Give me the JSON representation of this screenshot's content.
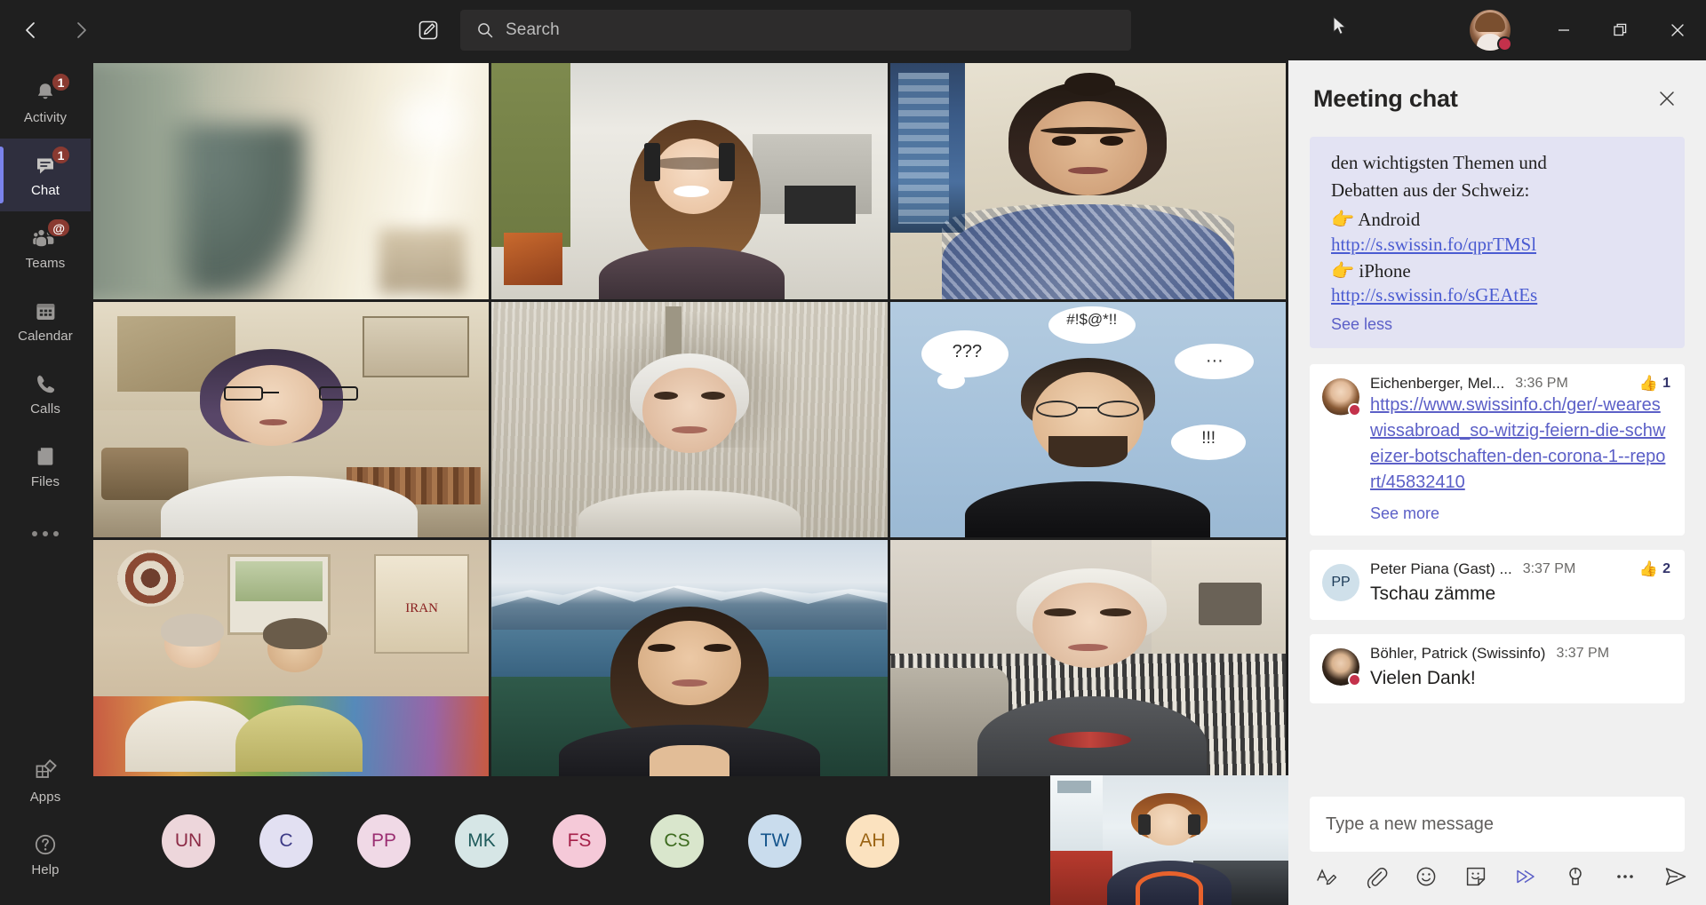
{
  "window": {
    "back_label": "Back",
    "forward_label": "Forward",
    "compose_label": "New chat",
    "minimize_label": "Minimize",
    "maximize_label": "Restore",
    "close_label": "Close",
    "user_presence": "busy",
    "presence_color": "#c4314b"
  },
  "search": {
    "placeholder": "Search",
    "value": "",
    "icon": "search-icon"
  },
  "rail": {
    "items": [
      {
        "id": "activity",
        "label": "Activity",
        "icon": "bell-icon",
        "badge": "1",
        "active": false
      },
      {
        "id": "chat",
        "label": "Chat",
        "icon": "chat-bubble-icon",
        "badge": "1",
        "active": true
      },
      {
        "id": "teams",
        "label": "Teams",
        "icon": "people-icon",
        "badge": "@",
        "active": false
      },
      {
        "id": "calendar",
        "label": "Calendar",
        "icon": "calendar-icon",
        "badge": "",
        "active": false
      },
      {
        "id": "calls",
        "label": "Calls",
        "icon": "phone-icon",
        "badge": "",
        "active": false
      },
      {
        "id": "files",
        "label": "Files",
        "icon": "file-icon",
        "badge": "",
        "active": false
      }
    ],
    "more_label": "More apps",
    "bottom": [
      {
        "id": "apps",
        "label": "Apps",
        "icon": "apps-grid-icon"
      },
      {
        "id": "help",
        "label": "Help",
        "icon": "question-circle-icon"
      }
    ],
    "active_accent": "#7b83eb",
    "badge_color": "#8a3a31"
  },
  "stage": {
    "tiles": [
      {
        "id": "tile-1",
        "position": "row1-col1"
      },
      {
        "id": "tile-2",
        "position": "row1-col2"
      },
      {
        "id": "tile-3",
        "position": "row1-col3"
      },
      {
        "id": "tile-4",
        "position": "row2-col1"
      },
      {
        "id": "tile-5",
        "position": "row2-col2"
      },
      {
        "id": "tile-6",
        "position": "row2-col3"
      },
      {
        "id": "tile-7",
        "position": "row3-col1"
      },
      {
        "id": "tile-8",
        "position": "row3-col2"
      },
      {
        "id": "tile-9",
        "position": "row3-col3"
      }
    ],
    "participant_pills": [
      {
        "initials": "UN",
        "bg": "#edd6db",
        "fg": "#8c2b46"
      },
      {
        "initials": "C",
        "bg": "#e2e0f2",
        "fg": "#3c3a86"
      },
      {
        "initials": "PP",
        "bg": "#f0d9e6",
        "fg": "#9b2f72"
      },
      {
        "initials": "MK",
        "bg": "#d6e6e6",
        "fg": "#1f5b5b"
      },
      {
        "initials": "FS",
        "bg": "#f5c9d8",
        "fg": "#a52049"
      },
      {
        "initials": "CS",
        "bg": "#d9e6cc",
        "fg": "#3d6b1f"
      },
      {
        "initials": "TW",
        "bg": "#c9dced",
        "fg": "#15558c"
      },
      {
        "initials": "AH",
        "bg": "#fbe2bf",
        "fg": "#9a6312"
      }
    ],
    "selfview_label": "Your video"
  },
  "chat": {
    "title": "Meeting chat",
    "close_label": "Close chat",
    "pinned_message": {
      "lines": [
        "den wichtigsten Themen und",
        "Debatten aus der Schweiz:"
      ],
      "items": [
        {
          "emoji": "👉",
          "label": "Android",
          "url": "http://s.swissin.fo/qprTMSl"
        },
        {
          "emoji": "👉",
          "label": "iPhone",
          "url": "http://s.swissin.fo/sGEAtEs"
        }
      ],
      "toggle_label": "See less"
    },
    "messages": [
      {
        "id": "msg-1",
        "author": "Eichenberger, Mel...",
        "time": "3:36 PM",
        "reaction_emoji": "👍",
        "reaction_count": "1",
        "link": "https://www.swissinfo.ch/ger/-weareswissabroad_so-witzig-feiern-die-schweizer-botschaften-den-corona-1--report/45832410",
        "text": "",
        "toggle_label": "See more",
        "avatar_type": "photo",
        "presence": "busy"
      },
      {
        "id": "msg-2",
        "author": "Peter Piana (Gast) ...",
        "time": "3:37 PM",
        "reaction_emoji": "👍",
        "reaction_count": "2",
        "link": "",
        "text": "Tschau zämme",
        "toggle_label": "",
        "avatar_type": "initials",
        "avatar_initials": "PP",
        "avatar_bg": "#cfe0ea",
        "avatar_fg": "#1b3a57",
        "presence": ""
      },
      {
        "id": "msg-3",
        "author": "Böhler, Patrick (Swissinfo)",
        "time": "3:37 PM",
        "reaction_emoji": "",
        "reaction_count": "",
        "link": "",
        "text": "Vielen Dank!",
        "toggle_label": "",
        "avatar_type": "photo",
        "presence": "busy"
      }
    ],
    "composer": {
      "placeholder": "Type a new message",
      "value": "",
      "tools": [
        {
          "id": "format",
          "icon": "format-text-icon",
          "label": "Format"
        },
        {
          "id": "attach",
          "icon": "paperclip-icon",
          "label": "Attach file"
        },
        {
          "id": "emoji",
          "icon": "emoji-smiley-icon",
          "label": "Emoji"
        },
        {
          "id": "giphy",
          "icon": "sticker-icon",
          "label": "Giphy"
        },
        {
          "id": "stream",
          "icon": "send-chevron-icon",
          "label": "Stream"
        },
        {
          "id": "praise",
          "icon": "praise-badge-icon",
          "label": "Praise"
        },
        {
          "id": "more",
          "icon": "ellipsis-icon",
          "label": "More options"
        }
      ],
      "send_label": "Send",
      "send_icon": "send-paper-plane-icon"
    }
  }
}
